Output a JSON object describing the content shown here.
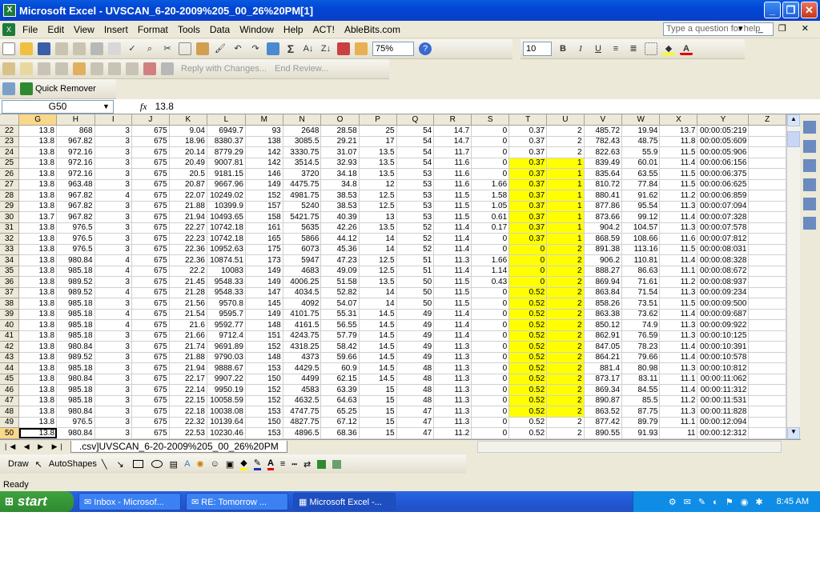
{
  "window": {
    "title": "Microsoft Excel - UVSCAN_6-20-2009%205_00_26%20PM[1]",
    "icon": "excel-icon"
  },
  "menu": [
    "File",
    "Edit",
    "View",
    "Insert",
    "Format",
    "Tools",
    "Data",
    "Window",
    "Help",
    "ACT!",
    "AbleBits.com"
  ],
  "help_box": {
    "placeholder": "Type a question for help"
  },
  "toolbar": {
    "zoom": "75%",
    "font_size": "10"
  },
  "review_bar": {
    "reply": "Reply with Changes...",
    "end": "End Review..."
  },
  "addin_bar": {
    "quick_remover": "Quick Remover"
  },
  "formula_bar": {
    "name_box": "G50",
    "fx": "fx",
    "value": "13.8"
  },
  "columns": [
    "G",
    "H",
    "I",
    "J",
    "K",
    "L",
    "M",
    "N",
    "O",
    "P",
    "Q",
    "R",
    "S",
    "T",
    "U",
    "V",
    "W",
    "X",
    "Y",
    "Z"
  ],
  "rows": [
    {
      "n": "22",
      "c": [
        "13.8",
        "868",
        "3",
        "675",
        "9.04",
        "6949.7",
        "93",
        "2648",
        "28.58",
        "25",
        "54",
        "14.7",
        "0",
        "0.37",
        "2",
        "485.72",
        "19.94",
        "13.7",
        "00:00:05:219"
      ]
    },
    {
      "n": "23",
      "c": [
        "13.8",
        "967.82",
        "3",
        "675",
        "18.96",
        "8380.37",
        "138",
        "3085.5",
        "29.21",
        "17",
        "54",
        "14.7",
        "0",
        "0.37",
        "2",
        "782.43",
        "48.75",
        "11.8",
        "00:00:05:609"
      ]
    },
    {
      "n": "24",
      "c": [
        "13.8",
        "972.16",
        "3",
        "675",
        "20.14",
        "8779.29",
        "142",
        "3330.75",
        "31.07",
        "13.5",
        "54",
        "11.7",
        "0",
        "0.37",
        "2",
        "822.63",
        "55.9",
        "11.5",
        "00:00:05:906"
      ]
    },
    {
      "n": "25",
      "c": [
        "13.8",
        "972.16",
        "3",
        "675",
        "20.49",
        "9007.81",
        "142",
        "3514.5",
        "32.93",
        "13.5",
        "54",
        "11.6",
        "0",
        "0.37",
        "1",
        "839.49",
        "60.01",
        "11.4",
        "00:00:06:156"
      ]
    },
    {
      "n": "26",
      "c": [
        "13.8",
        "972.16",
        "3",
        "675",
        "20.5",
        "9181.15",
        "146",
        "3720",
        "34.18",
        "13.5",
        "53",
        "11.6",
        "0",
        "0.37",
        "1",
        "835.64",
        "63.55",
        "11.5",
        "00:00:06:375"
      ]
    },
    {
      "n": "27",
      "c": [
        "13.8",
        "963.48",
        "3",
        "675",
        "20.87",
        "9667.96",
        "149",
        "4475.75",
        "34.8",
        "12",
        "53",
        "11.6",
        "1.66",
        "0.37",
        "1",
        "810.72",
        "77.84",
        "11.5",
        "00:00:06:625"
      ]
    },
    {
      "n": "28",
      "c": [
        "13.8",
        "967.82",
        "4",
        "675",
        "22.07",
        "10249.02",
        "152",
        "4981.75",
        "38.53",
        "12.5",
        "53",
        "11.5",
        "1.58",
        "0.37",
        "1",
        "880.41",
        "91.62",
        "11.2",
        "00:00:06:859"
      ]
    },
    {
      "n": "29",
      "c": [
        "13.8",
        "967.82",
        "3",
        "675",
        "21.88",
        "10399.9",
        "157",
        "5240",
        "38.53",
        "12.5",
        "53",
        "11.5",
        "1.05",
        "0.37",
        "1",
        "877.86",
        "95.54",
        "11.3",
        "00:00:07:094"
      ]
    },
    {
      "n": "30",
      "c": [
        "13.7",
        "967.82",
        "3",
        "675",
        "21.94",
        "10493.65",
        "158",
        "5421.75",
        "40.39",
        "13",
        "53",
        "11.5",
        "0.61",
        "0.37",
        "1",
        "873.66",
        "99.12",
        "11.4",
        "00:00:07:328"
      ]
    },
    {
      "n": "31",
      "c": [
        "13.8",
        "976.5",
        "3",
        "675",
        "22.27",
        "10742.18",
        "161",
        "5635",
        "42.26",
        "13.5",
        "52",
        "11.4",
        "0.17",
        "0.37",
        "1",
        "904.2",
        "104.57",
        "11.3",
        "00:00:07:578"
      ]
    },
    {
      "n": "32",
      "c": [
        "13.8",
        "976.5",
        "3",
        "675",
        "22.23",
        "10742.18",
        "165",
        "5866",
        "44.12",
        "14",
        "52",
        "11.4",
        "0",
        "0.37",
        "1",
        "868.59",
        "108.66",
        "11.6",
        "00:00:07:812"
      ]
    },
    {
      "n": "33",
      "c": [
        "13.8",
        "976.5",
        "3",
        "675",
        "22.36",
        "10952.63",
        "175",
        "6073",
        "45.36",
        "14",
        "52",
        "11.4",
        "0",
        "0",
        "2",
        "891.38",
        "113.16",
        "11.5",
        "00:00:08:031"
      ]
    },
    {
      "n": "34",
      "c": [
        "13.8",
        "980.84",
        "4",
        "675",
        "22.36",
        "10874.51",
        "173",
        "5947",
        "47.23",
        "12.5",
        "51",
        "11.3",
        "1.66",
        "0",
        "2",
        "906.2",
        "110.81",
        "11.4",
        "00:00:08:328"
      ]
    },
    {
      "n": "35",
      "c": [
        "13.8",
        "985.18",
        "4",
        "675",
        "22.2",
        "10083",
        "149",
        "4683",
        "49.09",
        "12.5",
        "51",
        "11.4",
        "1.14",
        "0",
        "2",
        "888.27",
        "86.63",
        "11.1",
        "00:00:08:672"
      ]
    },
    {
      "n": "36",
      "c": [
        "13.8",
        "989.52",
        "3",
        "675",
        "21.45",
        "9548.33",
        "149",
        "4006.25",
        "51.58",
        "13.5",
        "50",
        "11.5",
        "0.43",
        "0",
        "2",
        "869.94",
        "71.61",
        "11.2",
        "00:00:08:937"
      ]
    },
    {
      "n": "37",
      "c": [
        "13.8",
        "989.52",
        "4",
        "675",
        "21.28",
        "9548.33",
        "147",
        "4034.5",
        "52.82",
        "14",
        "50",
        "11.5",
        "0",
        "0.52",
        "2",
        "863.84",
        "71.54",
        "11.3",
        "00:00:09:234"
      ]
    },
    {
      "n": "38",
      "c": [
        "13.8",
        "985.18",
        "3",
        "675",
        "21.56",
        "9570.8",
        "145",
        "4092",
        "54.07",
        "14",
        "50",
        "11.5",
        "0",
        "0.52",
        "2",
        "858.26",
        "73.51",
        "11.5",
        "00:00:09:500"
      ]
    },
    {
      "n": "39",
      "c": [
        "13.8",
        "985.18",
        "4",
        "675",
        "21.54",
        "9595.7",
        "149",
        "4101.75",
        "55.31",
        "14.5",
        "49",
        "11.4",
        "0",
        "0.52",
        "2",
        "863.38",
        "73.62",
        "11.4",
        "00:00:09:687"
      ]
    },
    {
      "n": "40",
      "c": [
        "13.8",
        "985.18",
        "4",
        "675",
        "21.6",
        "9592.77",
        "148",
        "4161.5",
        "56.55",
        "14.5",
        "49",
        "11.4",
        "0",
        "0.52",
        "2",
        "850.12",
        "74.9",
        "11.3",
        "00:00:09:922"
      ]
    },
    {
      "n": "41",
      "c": [
        "13.8",
        "985.18",
        "3",
        "675",
        "21.66",
        "9712.4",
        "151",
        "4243.75",
        "57.79",
        "14.5",
        "49",
        "11.4",
        "0",
        "0.52",
        "2",
        "862.91",
        "76.59",
        "11.3",
        "00:00:10:125"
      ]
    },
    {
      "n": "42",
      "c": [
        "13.8",
        "980.84",
        "3",
        "675",
        "21.74",
        "9691.89",
        "152",
        "4318.25",
        "58.42",
        "14.5",
        "49",
        "11.3",
        "0",
        "0.52",
        "2",
        "847.05",
        "78.23",
        "11.4",
        "00:00:10:391"
      ]
    },
    {
      "n": "43",
      "c": [
        "13.8",
        "989.52",
        "3",
        "675",
        "21.88",
        "9790.03",
        "148",
        "4373",
        "59.66",
        "14.5",
        "49",
        "11.3",
        "0",
        "0.52",
        "2",
        "864.21",
        "79.66",
        "11.4",
        "00:00:10:578"
      ]
    },
    {
      "n": "44",
      "c": [
        "13.8",
        "985.18",
        "3",
        "675",
        "21.94",
        "9888.67",
        "153",
        "4429.5",
        "60.9",
        "14.5",
        "48",
        "11.3",
        "0",
        "0.52",
        "2",
        "881.4",
        "80.98",
        "11.3",
        "00:00:10:812"
      ]
    },
    {
      "n": "45",
      "c": [
        "13.8",
        "980.84",
        "3",
        "675",
        "22.17",
        "9907.22",
        "150",
        "4499",
        "62.15",
        "14.5",
        "48",
        "11.3",
        "0",
        "0.52",
        "2",
        "873.17",
        "83.11",
        "11.1",
        "00:00:11:062"
      ]
    },
    {
      "n": "46",
      "c": [
        "13.8",
        "985.18",
        "3",
        "675",
        "22.14",
        "9950.19",
        "152",
        "4583",
        "63.39",
        "15",
        "48",
        "11.3",
        "0",
        "0.52",
        "2",
        "869.34",
        "84.55",
        "11.4",
        "00:00:11:312"
      ]
    },
    {
      "n": "47",
      "c": [
        "13.8",
        "985.18",
        "3",
        "675",
        "22.15",
        "10058.59",
        "152",
        "4632.5",
        "64.63",
        "15",
        "48",
        "11.3",
        "0",
        "0.52",
        "2",
        "890.87",
        "85.5",
        "11.2",
        "00:00:11:531"
      ]
    },
    {
      "n": "48",
      "c": [
        "13.8",
        "980.84",
        "3",
        "675",
        "22.18",
        "10038.08",
        "153",
        "4747.75",
        "65.25",
        "15",
        "47",
        "11.3",
        "0",
        "0.52",
        "2",
        "863.52",
        "87.75",
        "11.3",
        "00:00:11:828"
      ]
    },
    {
      "n": "49",
      "c": [
        "13.8",
        "976.5",
        "3",
        "675",
        "22.32",
        "10139.64",
        "150",
        "4827.75",
        "67.12",
        "15",
        "47",
        "11.3",
        "0",
        "0.52",
        "2",
        "877.42",
        "89.79",
        "11.1",
        "00:00:12:094"
      ]
    },
    {
      "n": "50",
      "c": [
        "13.8",
        "980.84",
        "3",
        "675",
        "22.53",
        "10230.46",
        "153",
        "4896.5",
        "68.36",
        "15",
        "47",
        "11.2",
        "0",
        "0.52",
        "2",
        "890.55",
        "91.93",
        "11",
        "00:00:12:312"
      ]
    }
  ],
  "highlight": {
    "color": "#ffff00",
    "rows_from": 25,
    "rows_to": 48,
    "cols": [
      "T",
      "U"
    ]
  },
  "sheet_tab": ".csv]UVSCAN_6-20-2009%205_00_26%20PM",
  "draw_bar": {
    "draw": "Draw",
    "autoshapes": "AutoShapes"
  },
  "status": "Ready",
  "taskbar": {
    "start": "start",
    "tasks": [
      {
        "label": "Inbox - Microsof...",
        "icon": "outlook-icon"
      },
      {
        "label": "RE: Tomorrow ...",
        "icon": "mail-icon"
      },
      {
        "label": "Microsoft Excel -...",
        "icon": "excel-icon",
        "active": true
      }
    ],
    "clock": "8:45 AM"
  }
}
